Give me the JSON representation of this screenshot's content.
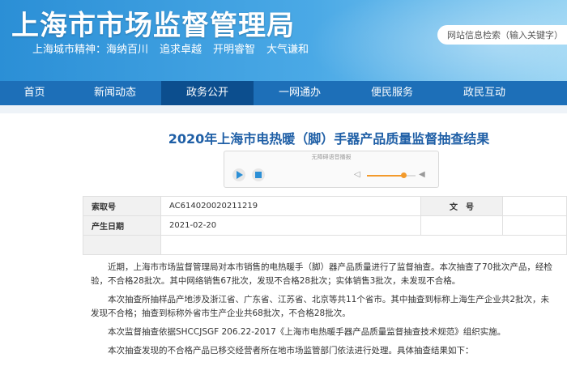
{
  "header": {
    "title": "上海市市场监督管理局",
    "spirit": [
      "上海城市精神：海纳百川",
      "追求卓越",
      "开明睿智",
      "大气谦和"
    ],
    "search_placeholder": "网站信息检索（输入关键字）"
  },
  "nav": {
    "items": [
      "首页",
      "新闻动态",
      "政务公开",
      "一网通办",
      "便民服务",
      "政民互动"
    ],
    "active": "政务公开"
  },
  "article": {
    "title": "2020年上海市电热暖（脚）手器产品质量监督抽查结果"
  },
  "player": {
    "caption": "无障碍语音播报",
    "volume": 0.75
  },
  "meta": {
    "index_label": "索取号",
    "index_value": "AC614020020211219",
    "doc_label": "文　号",
    "date_label": "产生日期",
    "date_value": "2021-02-20"
  },
  "body": {
    "p1a": "近期，上海市市场监督管理局对本市销售的电热暖手（脚）器产品质量进行了监督抽查。本次抽查了70批次产品，经检",
    "p1b": "验，不合格28批次。其中网络销售67批次，发现不合格28批次；实体销售3批次，未发现不合格。",
    "p2a": "本次抽查所抽样品产地涉及浙江省、广东省、江苏省、北京等共11个省市。其中抽查到标称上海生产企业共2批次，未",
    "p2b": "发现不合格；抽查到标称外省市生产企业共68批次，不合格28批次。",
    "p3": "本次监督抽查依据SHCCJSGF 206.22-2017《上海市电热暖手器产品质量监督抽查技术规范》组织实施。",
    "p4": "本次抽查发现的不合格产品已移交经营者所在地市场监管部门依法进行处理。具体抽查结果如下："
  }
}
